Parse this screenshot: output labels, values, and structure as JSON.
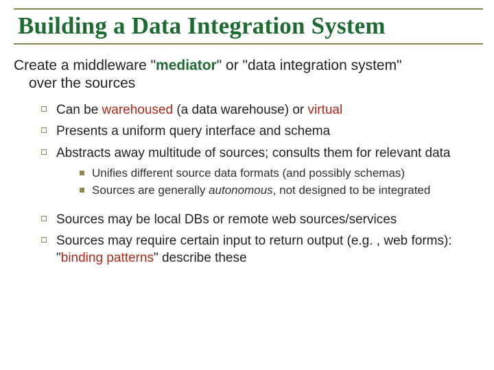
{
  "title": "Building a Data Integration System",
  "intro": {
    "line1_a": "Create a middleware \"",
    "line1_b": "mediator",
    "line1_c": "\" or \"data integration system\"",
    "line2": "over the sources"
  },
  "bullets": {
    "b1_a": "Can be ",
    "b1_b": "warehoused",
    "b1_c": " (a data warehouse) or ",
    "b1_d": "virtual",
    "b2": "Presents a uniform query interface and schema",
    "b3": "Abstracts away multitude of sources; consults them for relevant data",
    "sub1": "Unifies different source data formats (and possibly schemas)",
    "sub2_a": "Sources are generally ",
    "sub2_b": "autonomous",
    "sub2_c": ", not designed to be integrated",
    "b4": "Sources may be local DBs or remote web sources/services",
    "b5_a": "Sources may require certain input to return output (e.g. , web forms): \"",
    "b5_b": "binding patterns",
    "b5_c": "\" describe these"
  }
}
